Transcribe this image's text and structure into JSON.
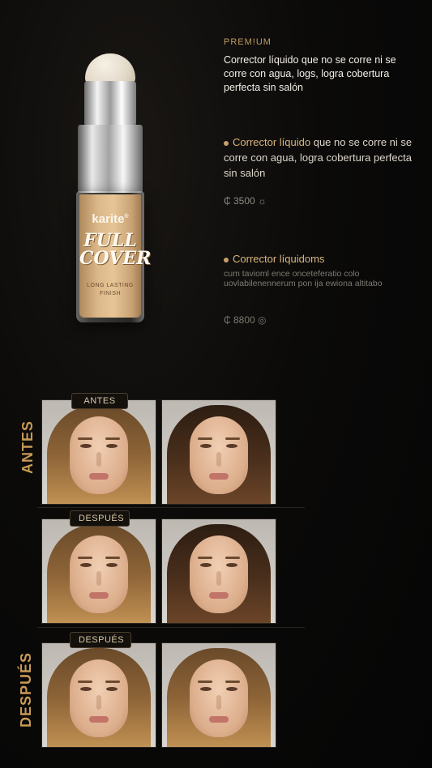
{
  "product": {
    "brand": "karite",
    "brand_mark": "®",
    "name_line1": "FULL",
    "name_line2": "COVER",
    "sub_line1": "LONG LASTING",
    "sub_line2": "FINISH"
  },
  "info": {
    "badge": "PREM!UM",
    "description": "Corrector líquido que no se corre ni se corre con agua, logs, logra cobertura perfecta sin salón"
  },
  "features": [
    {
      "title": "Corrector líquido",
      "body": " que no se corre ni se corre con agua, logra cobertura perfecta sin salón",
      "price": "₵ 3500 ☼"
    },
    {
      "title": "Corrector líquidoms",
      "body": "cum tavioml ence onceteferatio colo uovlabilenennerum pon ija ewiona altitabo",
      "price": "₵ 8800 ◎"
    }
  ],
  "comparison": {
    "side_label_top": "ANTES",
    "side_label_bottom": "DESPUÉS",
    "row_labels": [
      "ANTES",
      "DESPUÉS",
      "DESPUÉS"
    ]
  },
  "colors": {
    "accent_gold": "#c79a55",
    "background": "#0b0a09"
  }
}
